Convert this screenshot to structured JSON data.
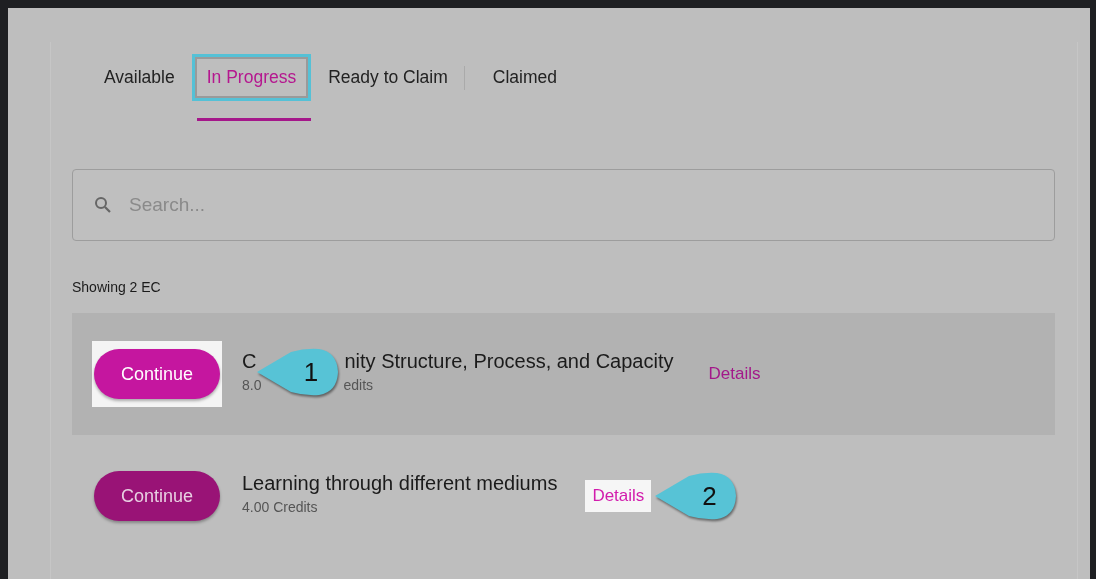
{
  "tabs": [
    {
      "label": "Available",
      "selected": false,
      "spotlight": false,
      "divider_after": false
    },
    {
      "label": "In Progress",
      "selected": true,
      "spotlight": true,
      "divider_after": false
    },
    {
      "label": "Ready to Claim",
      "selected": false,
      "spotlight": false,
      "divider_after": true
    },
    {
      "label": "Claimed",
      "selected": false,
      "spotlight": false,
      "divider_after": false
    }
  ],
  "search": {
    "placeholder": "Search..."
  },
  "result_count": "Showing 2 EC",
  "items": [
    {
      "selected": true,
      "button": "Continue",
      "button_spotlight": true,
      "title_parts": [
        "C",
        "nity Structure, Process, and Capacity"
      ],
      "credits_parts": [
        "8.0",
        "edits"
      ],
      "details": "Details",
      "details_spotlight": false,
      "callout": {
        "number": "1",
        "kind": "overlay"
      }
    },
    {
      "selected": false,
      "button": "Continue",
      "button_spotlight": false,
      "title_parts": [
        "Learning through different mediums"
      ],
      "credits_parts": [
        "4.00 Credits"
      ],
      "details": "Details",
      "details_spotlight": true,
      "callout": {
        "number": "2",
        "kind": "trailing"
      }
    }
  ]
}
